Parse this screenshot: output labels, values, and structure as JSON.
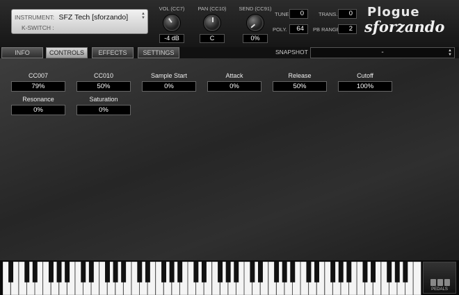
{
  "instrument": {
    "label": "INSTRUMENT:",
    "value": "SFZ Tech [sforzando]",
    "kswitch_label": "K-SWITCH :",
    "kswitch_value": ""
  },
  "knobs": [
    {
      "label": "VOL (CC7)",
      "value": "-4 dB"
    },
    {
      "label": "PAN (CC10)",
      "value": "C"
    },
    {
      "label": "SEND (CC91)",
      "value": "0%"
    }
  ],
  "params": {
    "tune_label": "TUNE",
    "tune": "0",
    "poly_label": "POLY.",
    "poly": "64",
    "trans_label": "TRANS.",
    "trans": "0",
    "pb_label": "PB RANGE",
    "pb": "2"
  },
  "logo": {
    "brand": "Plogue",
    "product": "sforzando"
  },
  "tabs": [
    {
      "label": "INFO"
    },
    {
      "label": "CONTROLS"
    },
    {
      "label": "EFFECTS"
    },
    {
      "label": "SETTINGS"
    }
  ],
  "active_tab": "CONTROLS",
  "snapshot": {
    "label": "SNAPSHOT",
    "value": "-"
  },
  "controls": [
    {
      "label": "CC007",
      "value": "79%"
    },
    {
      "label": "CC010",
      "value": "50%"
    },
    {
      "label": "Sample Start",
      "value": "0%"
    },
    {
      "label": "Attack",
      "value": "0%"
    },
    {
      "label": "Release",
      "value": "50%"
    },
    {
      "label": "Cutoff",
      "value": "100%"
    },
    {
      "label": "Resonance",
      "value": "0%"
    },
    {
      "label": "Saturation",
      "value": "0%"
    }
  ],
  "pedals_label": "PEDALS",
  "colors": {
    "panel_bg": "#2c2c2c",
    "value_box": "#000000",
    "active_tab": "#c8c8c8",
    "white_key": "#f4f4f4",
    "black_key": "#111111"
  }
}
